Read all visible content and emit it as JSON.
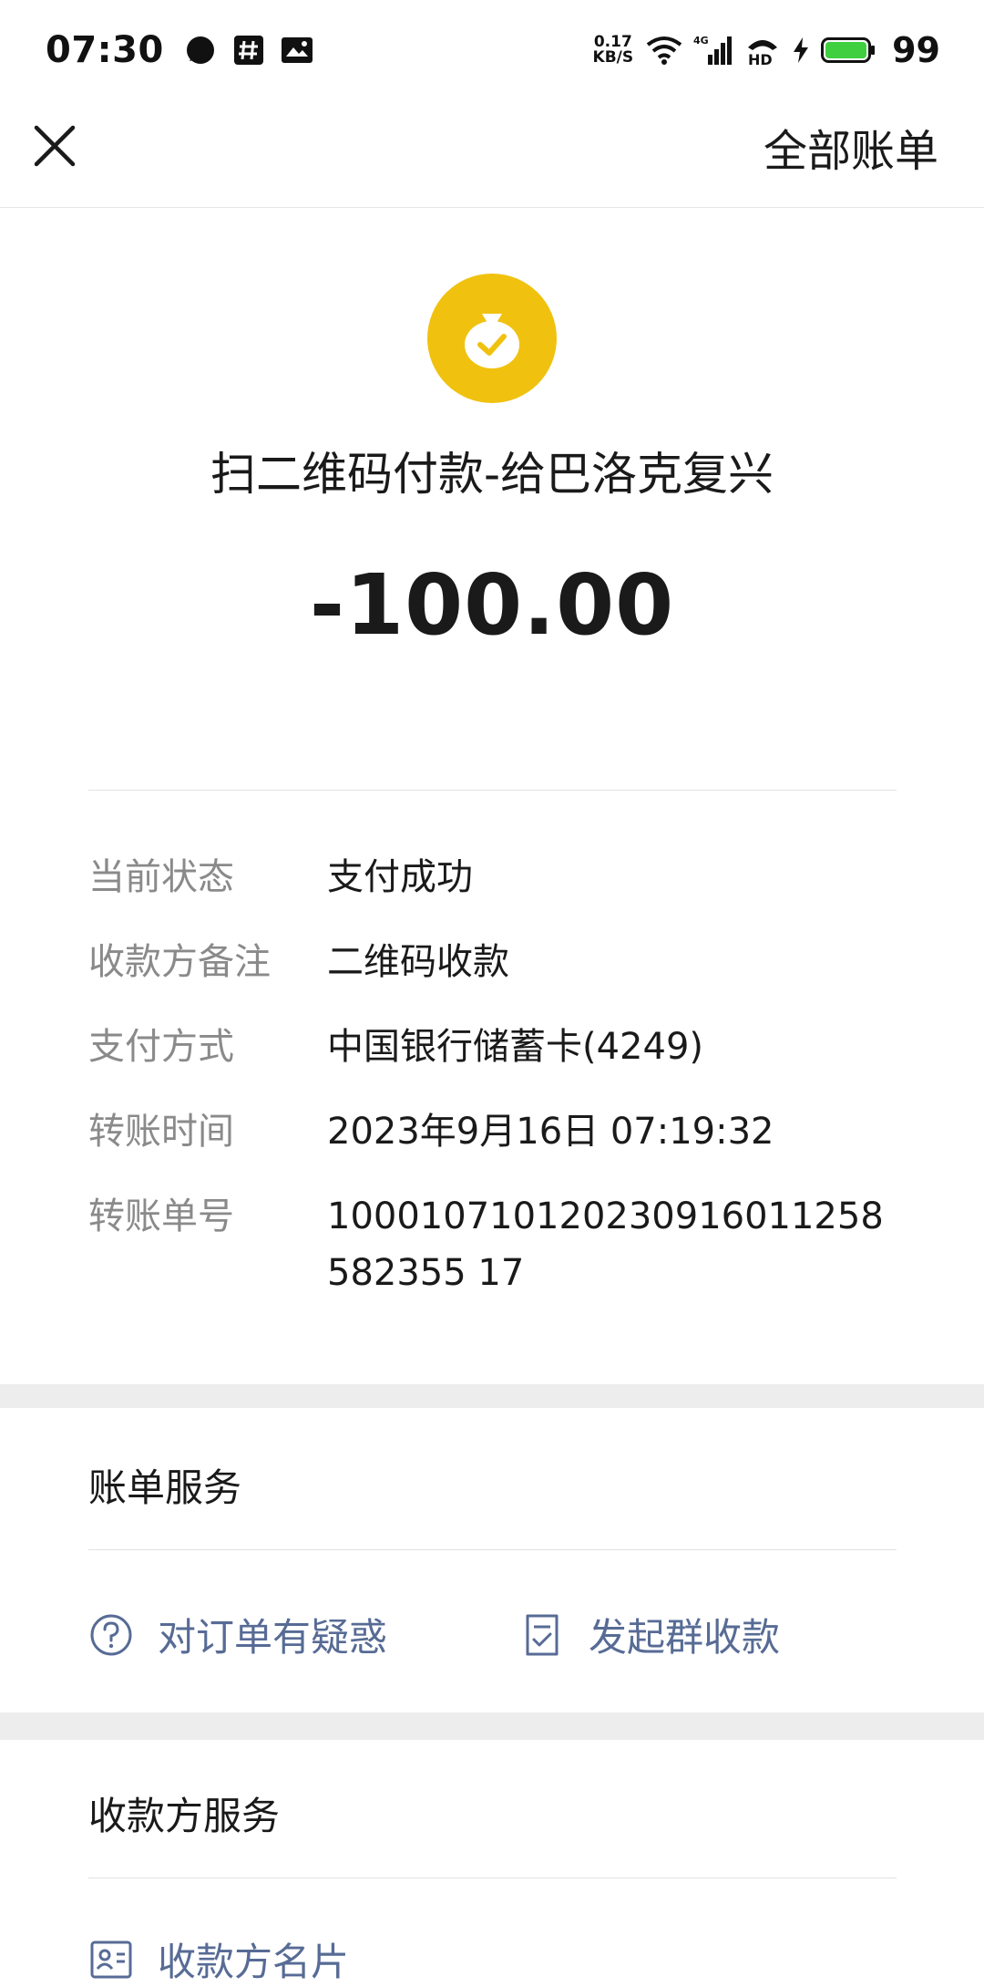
{
  "status_bar": {
    "time": "07:30",
    "net_speed_value": "0.17",
    "net_speed_unit": "KB/S",
    "network_type": "4G",
    "battery": "99"
  },
  "header": {
    "all_bills_label": "全部账单"
  },
  "summary": {
    "title": "扫二维码付款-给巴洛克复兴",
    "amount": "-100.00",
    "icon_color": "#f0c20f"
  },
  "details": {
    "status_label": "当前状态",
    "status_value": "支付成功",
    "remark_label": "收款方备注",
    "remark_value": "二维码收款",
    "method_label": "支付方式",
    "method_value": "中国银行储蓄卡(4249)",
    "time_label": "转账时间",
    "time_value": "2023年9月16日 07:19:32",
    "order_label": "转账单号",
    "order_value": "100010710120230916011258582355 17"
  },
  "bill_service": {
    "title": "账单服务",
    "doubt_label": "对订单有疑惑",
    "group_collect_label": "发起群收款"
  },
  "payee_service": {
    "title": "收款方服务",
    "card_label": "收款方名片"
  },
  "colors": {
    "link": "#576b95",
    "background_band": "#ededed"
  }
}
